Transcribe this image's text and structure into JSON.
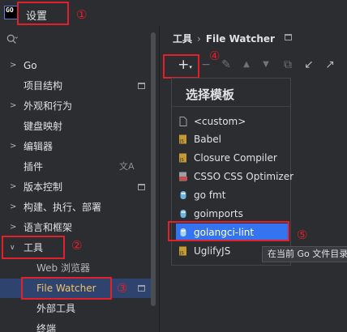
{
  "window": {
    "logo_text": "GO",
    "title": "设置"
  },
  "markers": {
    "m1": "①",
    "m2": "②",
    "m3": "③",
    "m4": "④",
    "m5": "⑤"
  },
  "sidebar": {
    "items": [
      {
        "label": "Go"
      },
      {
        "label": "项目结构"
      },
      {
        "label": "外观和行为"
      },
      {
        "label": "键盘映射"
      },
      {
        "label": "编辑器"
      },
      {
        "label": "插件"
      },
      {
        "label": "版本控制"
      },
      {
        "label": "构建、执行、部署"
      },
      {
        "label": "语言和框架"
      },
      {
        "label": "工具"
      },
      {
        "label": "Web 浏览器"
      },
      {
        "label": "File Watcher"
      },
      {
        "label": "外部工具"
      },
      {
        "label": "终端"
      }
    ],
    "translate_icon_text": "文A"
  },
  "header": {
    "parent": "工具",
    "separator": "›",
    "current": "File Watcher"
  },
  "toolbar": {
    "add": "+",
    "add_caret": "▾",
    "remove": "−",
    "edit": "✎",
    "up": "▲",
    "down": "▼",
    "copy": "⧉",
    "import": "↙",
    "export": "↗"
  },
  "popup": {
    "title": "选择模板",
    "templates": [
      {
        "label": "<custom>",
        "icon": "file-icon"
      },
      {
        "label": "Babel",
        "icon": "js-file-icon"
      },
      {
        "label": "Closure Compiler",
        "icon": "js-file-icon"
      },
      {
        "label": "CSSO CSS Optimizer",
        "icon": "css-file-icon"
      },
      {
        "label": "go fmt",
        "icon": "gopher-icon"
      },
      {
        "label": "goimports",
        "icon": "gopher-icon"
      },
      {
        "label": "golangci-lint",
        "icon": "gopher-icon"
      },
      {
        "label": "UglifyJS",
        "icon": "js-file-icon"
      }
    ]
  },
  "tooltip": {
    "text": "在当前 Go 文件目录"
  },
  "colors": {
    "accent": "#3574f0",
    "annotation": "#e0202a",
    "selected_text": "#f0c36a"
  }
}
